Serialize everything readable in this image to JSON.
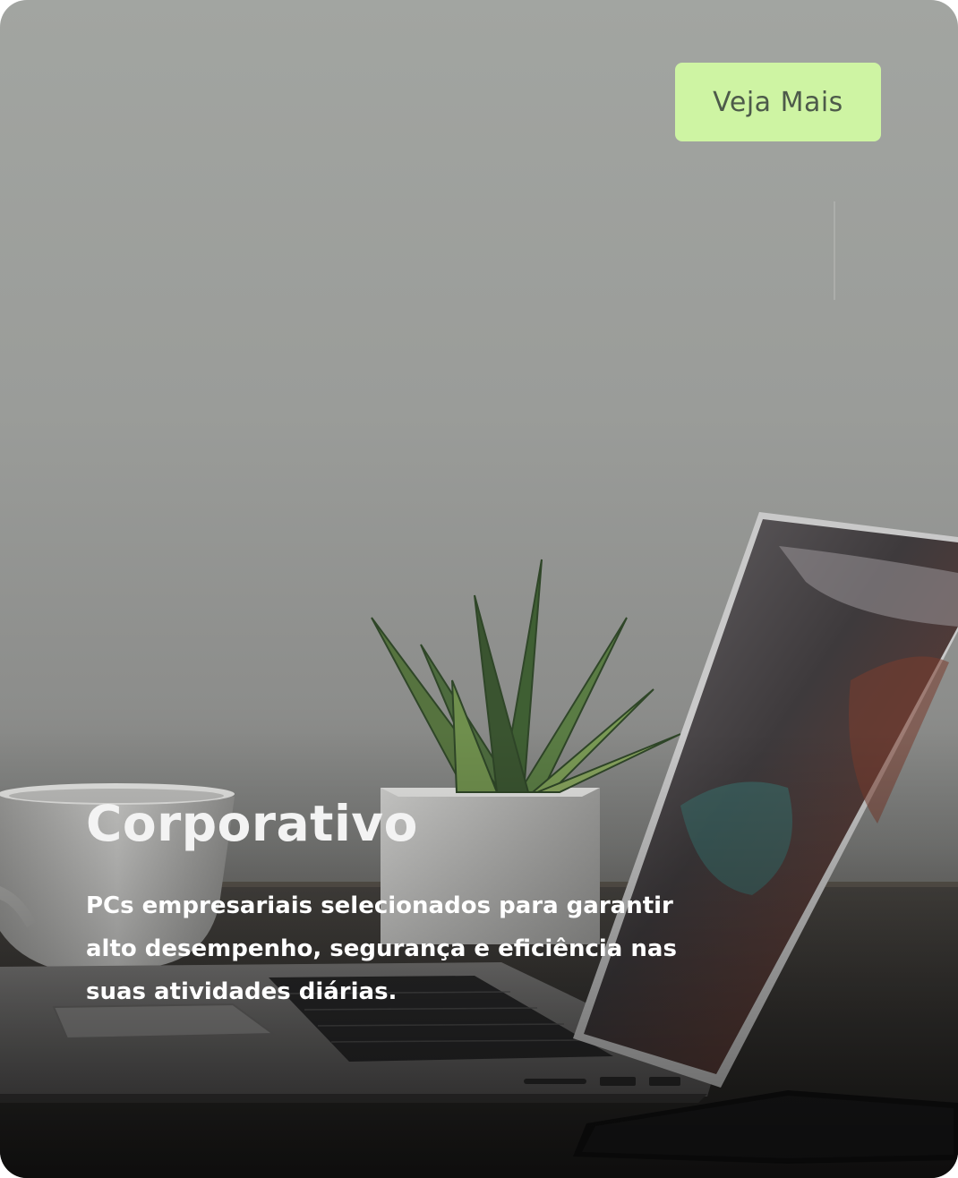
{
  "card": {
    "cta_label": "Veja Mais",
    "title": "Corporativo",
    "description": "PCs empresariais selecionados para garantir alto desempenho, segurança e eficiência nas suas atividades diárias.",
    "background_image": "photo of laptop, potted succulent plant and coffee cup on a desk",
    "accent_color": "#cef4a3"
  }
}
